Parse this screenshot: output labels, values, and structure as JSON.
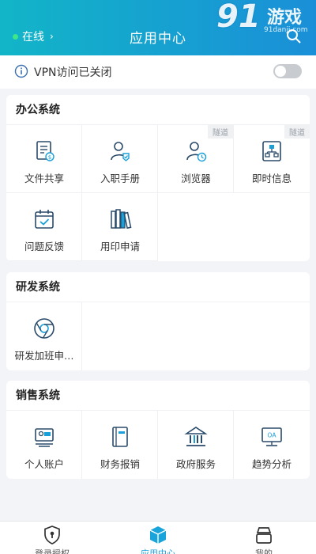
{
  "header": {
    "status": "在线",
    "title": "应用中心",
    "watermark_number": "91",
    "watermark_text": "游戏",
    "watermark_site": "91danji.com"
  },
  "vpn": {
    "text": "VPN访问已关闭",
    "enabled": false
  },
  "sections": [
    {
      "title": "办公系统",
      "items": [
        {
          "label": "文件共享",
          "icon": "file-share-icon",
          "badge": ""
        },
        {
          "label": "入职手册",
          "icon": "onboarding-user-icon",
          "badge": ""
        },
        {
          "label": "浏览器",
          "icon": "user-clock-icon",
          "badge": "隧道"
        },
        {
          "label": "即时信息",
          "icon": "org-chart-icon",
          "badge": "隧道"
        },
        {
          "label": "问题反馈",
          "icon": "calendar-check-icon",
          "badge": ""
        },
        {
          "label": "用印申请",
          "icon": "books-icon",
          "badge": ""
        }
      ]
    },
    {
      "title": "研发系统",
      "items": [
        {
          "label": "研发加班申…",
          "icon": "chrome-icon",
          "badge": ""
        }
      ]
    },
    {
      "title": "销售系统",
      "items": [
        {
          "label": "个人账户",
          "icon": "account-card-icon",
          "badge": ""
        },
        {
          "label": "财务报销",
          "icon": "ledger-icon",
          "badge": ""
        },
        {
          "label": "政府服务",
          "icon": "government-building-icon",
          "badge": ""
        },
        {
          "label": "趋势分析",
          "icon": "oa-monitor-icon",
          "badge": "",
          "icon_text": "OA"
        }
      ]
    }
  ],
  "tabbar": {
    "tabs": [
      {
        "label": "登录授权",
        "icon": "shield-lock-icon",
        "active": false
      },
      {
        "label": "应用中心",
        "icon": "app-box-icon",
        "active": true
      },
      {
        "label": "我的",
        "icon": "profile-icon",
        "active": false
      }
    ]
  },
  "colors": {
    "accent": "#1a9fd8",
    "header_start": "#12b5c8",
    "header_end": "#1a8fd8",
    "icon": "#2a4a6a"
  }
}
